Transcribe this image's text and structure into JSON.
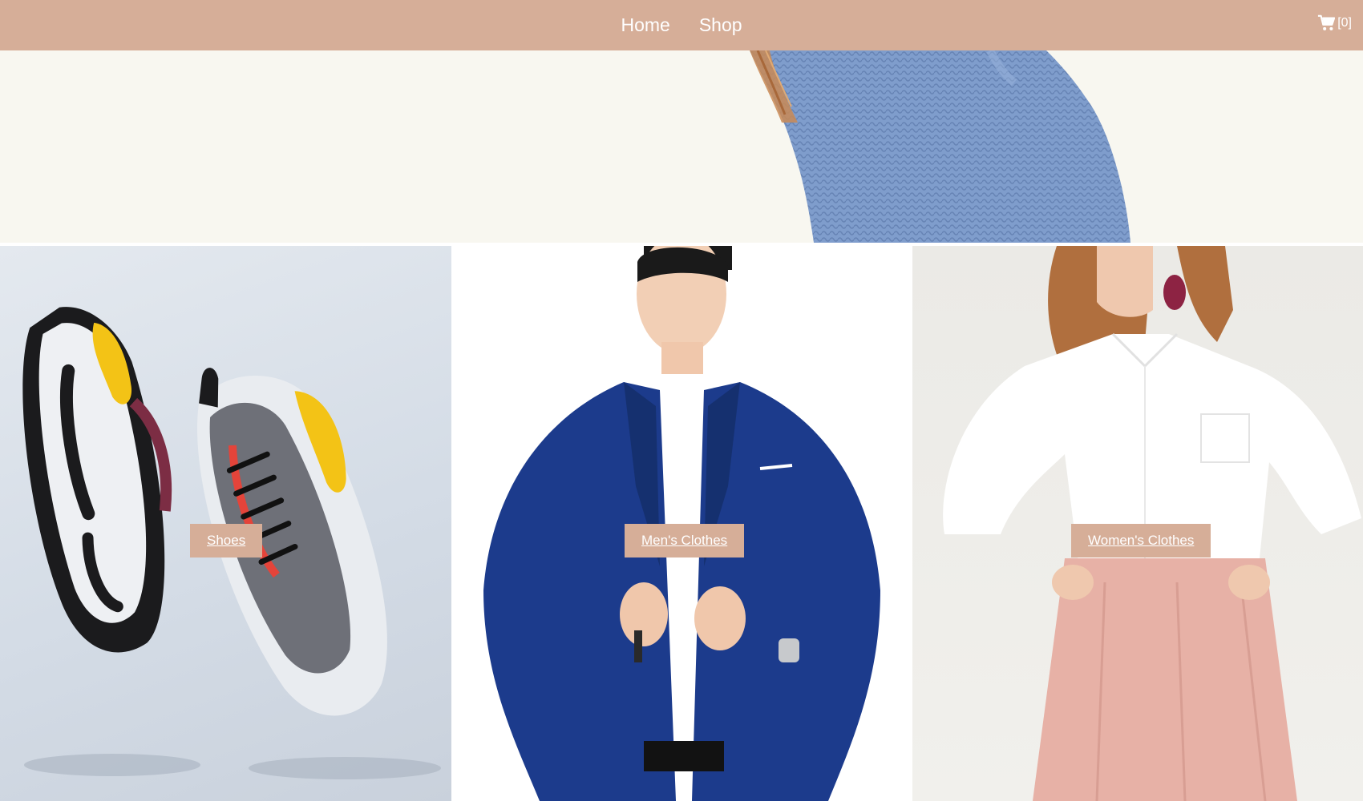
{
  "nav": {
    "links": [
      {
        "label": "Home"
      },
      {
        "label": "Shop"
      }
    ],
    "cart": {
      "icon": "cart-icon",
      "count_text": "[0]"
    }
  },
  "colors": {
    "brand": "#d6ae98",
    "hero_bg": "#f8f7f0"
  },
  "categories": [
    {
      "label": "Shoes"
    },
    {
      "label": "Men's Clothes"
    },
    {
      "label": "Women's Clothes"
    }
  ]
}
